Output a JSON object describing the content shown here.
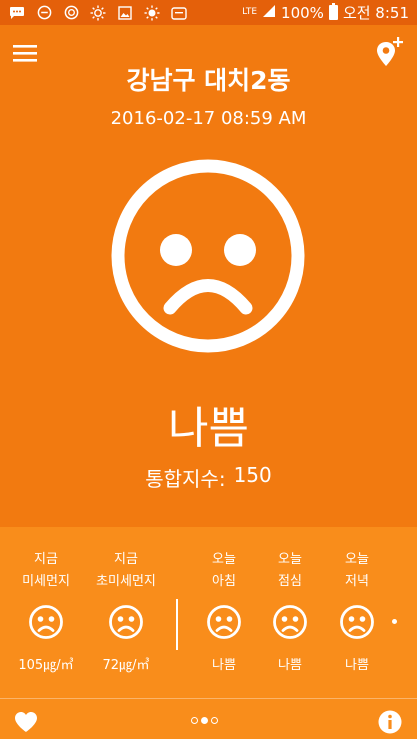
{
  "status_bar": {
    "icons": [
      "chat-icon",
      "minus-circle-icon",
      "sync-icon",
      "brightness-icon",
      "image-icon",
      "sun-icon",
      "calendar-icon"
    ],
    "network": "LTE",
    "battery": "100%",
    "time": "오전 8:51"
  },
  "header": {
    "location": "강남구 대치2동",
    "datetime": "2016-02-17 08:59 AM"
  },
  "main": {
    "status": "나쁨",
    "index_label": "통합지수:",
    "index_value": "150"
  },
  "forecast": [
    {
      "line1": "지금",
      "line2": "미세먼지",
      "value": "105㎍/㎥",
      "face": "sad-face-icon"
    },
    {
      "line1": "지금",
      "line2": "초미세먼지",
      "value": "72㎍/㎥",
      "face": "sad-face-icon"
    },
    {
      "line1": "오늘",
      "line2": "아침",
      "value": "나쁨",
      "face": "sad-face-icon"
    },
    {
      "line1": "오늘",
      "line2": "점심",
      "value": "나쁨",
      "face": "sad-face-icon"
    },
    {
      "line1": "오늘",
      "line2": "저녁",
      "value": "나쁨",
      "face": "sad-face-icon"
    }
  ],
  "pager": {
    "count": 3,
    "active": 2
  },
  "colors": {
    "background": "#f27a10",
    "status_bar": "#e4600a",
    "panel": "#f98d1b",
    "foreground": "#ffffff"
  }
}
